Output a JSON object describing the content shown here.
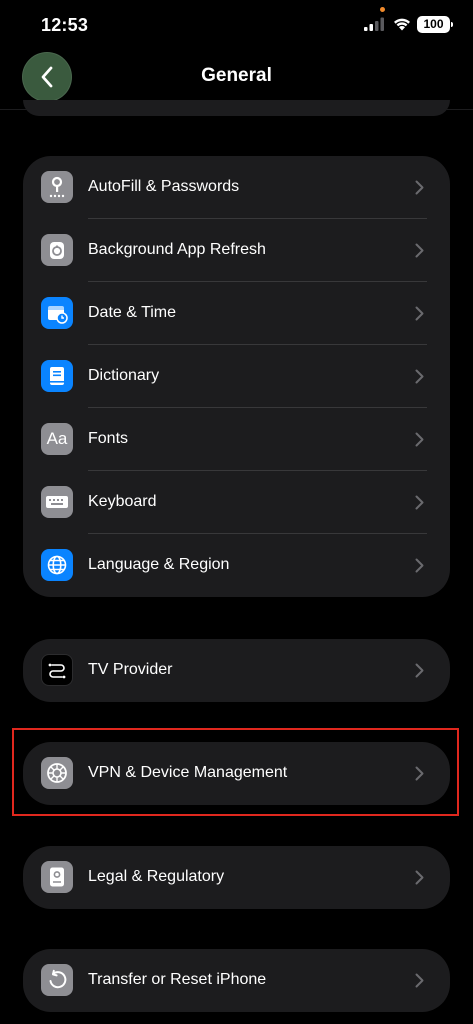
{
  "status_bar": {
    "time": "12:53",
    "battery": "100"
  },
  "nav": {
    "title": "General"
  },
  "groups": [
    {
      "rows": [
        {
          "label": "AutoFill & Passwords",
          "icon": "key-icon",
          "color": "#8e8e93"
        },
        {
          "label": "Background App Refresh",
          "icon": "refresh-gear-icon",
          "color": "#8e8e93"
        },
        {
          "label": "Date & Time",
          "icon": "calendar-clock-icon",
          "color": "#0a84ff"
        },
        {
          "label": "Dictionary",
          "icon": "book-icon",
          "color": "#0a84ff"
        },
        {
          "label": "Fonts",
          "icon": "fonts-aa-icon",
          "color": "#8e8e93"
        },
        {
          "label": "Keyboard",
          "icon": "keyboard-icon",
          "color": "#8e8e93"
        },
        {
          "label": "Language & Region",
          "icon": "globe-icon",
          "color": "#0a84ff"
        }
      ]
    },
    {
      "rows": [
        {
          "label": "TV Provider",
          "icon": "tv-provider-icon",
          "color": "#000000"
        }
      ]
    },
    {
      "rows": [
        {
          "label": "VPN & Device Management",
          "icon": "gear-icon",
          "color": "#8e8e93"
        }
      ]
    },
    {
      "rows": [
        {
          "label": "Legal & Regulatory",
          "icon": "document-icon",
          "color": "#8e8e93"
        }
      ]
    },
    {
      "rows": [
        {
          "label": "Transfer or Reset iPhone",
          "icon": "reset-arrow-icon",
          "color": "#8e8e93"
        }
      ]
    }
  ],
  "highlight": {
    "color": "#e0281e",
    "target": "VPN & Device Management"
  }
}
